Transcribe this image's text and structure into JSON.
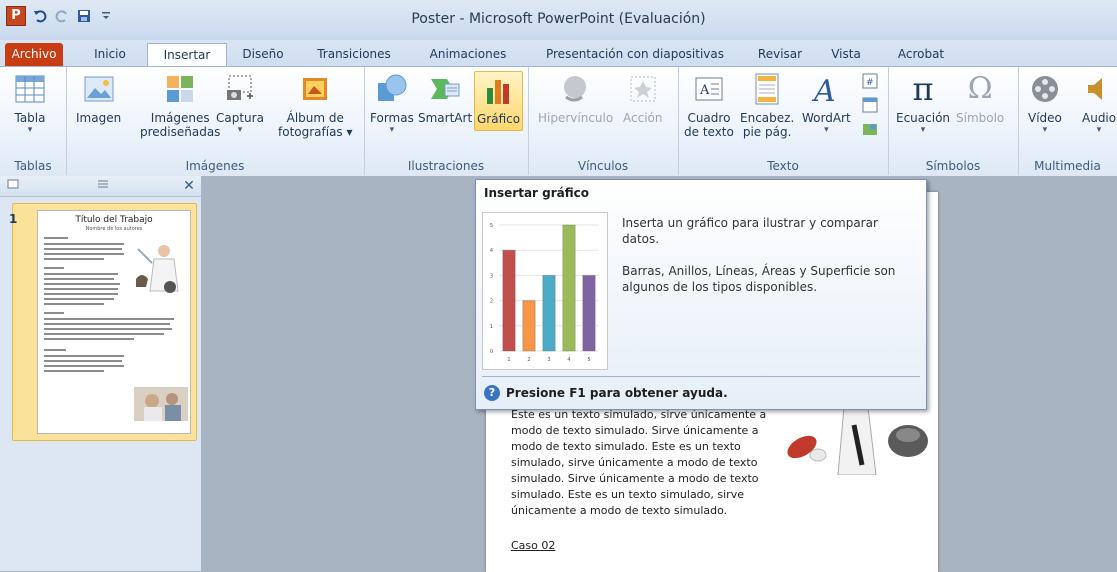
{
  "window": {
    "title": "Poster  -  Microsoft PowerPoint (Evaluación)",
    "logo": "P"
  },
  "tabs": [
    "Archivo",
    "Inicio",
    "Insertar",
    "Diseño",
    "Transiciones",
    "Animaciones",
    "Presentación con diapositivas",
    "Revisar",
    "Vista",
    "Acrobat"
  ],
  "ribbon": {
    "groups": {
      "tablas": "Tablas",
      "imagenes": "Imágenes",
      "ilustraciones": "Ilustraciones",
      "vinculos": "Vínculos",
      "texto": "Texto",
      "simbolos": "Símbolos",
      "multimedia": "Multimedia"
    },
    "buttons": {
      "tabla": "Tabla",
      "imagen": "Imagen",
      "imagenes_pred_1": "Imágenes",
      "imagenes_pred_2": "prediseñadas",
      "captura": "Captura",
      "album_1": "Álbum de",
      "album_2": "fotografías ▾",
      "formas": "Formas",
      "smartart": "SmartArt",
      "grafico": "Gráfico",
      "hipervinculo": "Hipervínculo",
      "accion": "Acción",
      "cuadro_1": "Cuadro",
      "cuadro_2": "de texto",
      "encabez_1": "Encabez.",
      "encabez_2": "pie pág.",
      "wordart": "WordArt",
      "ecuacion": "Ecuación",
      "simbolo": "Símbolo",
      "video": "Vídeo",
      "audio": "Audio"
    }
  },
  "thumbnail": {
    "number": "1",
    "title": "Título del Trabajo",
    "subtitle": "Nombre de los autores"
  },
  "tooltip": {
    "title": "Insertar gráfico",
    "desc1": "Inserta un gráfico para ilustrar y comparar datos.",
    "desc2": "Barras, Anillos, Líneas, Áreas y Superficie son algunos de los tipos disponibles.",
    "help": "Presione F1 para obtener ayuda."
  },
  "slide": {
    "body": "Este es un texto simulado, sirve únicamente a modo de texto simulado. Sirve únicamente a modo de texto simulado. Este es un texto simulado, sirve únicamente a modo de texto simulado. Sirve únicamente a modo de texto simulado. Este es un texto simulado, sirve únicamente  a modo de texto simulado.",
    "case": "Caso 02"
  },
  "chart_preview": {
    "categories": [
      "1",
      "2",
      "3",
      "4",
      "5"
    ],
    "values": [
      4,
      2,
      3,
      5,
      3
    ],
    "y_ticks": [
      "0",
      "1",
      "2",
      "3",
      "4",
      "5"
    ],
    "colors": [
      "#c0504d",
      "#f79646",
      "#4bacc6",
      "#9bbb59",
      "#8064a2"
    ]
  }
}
